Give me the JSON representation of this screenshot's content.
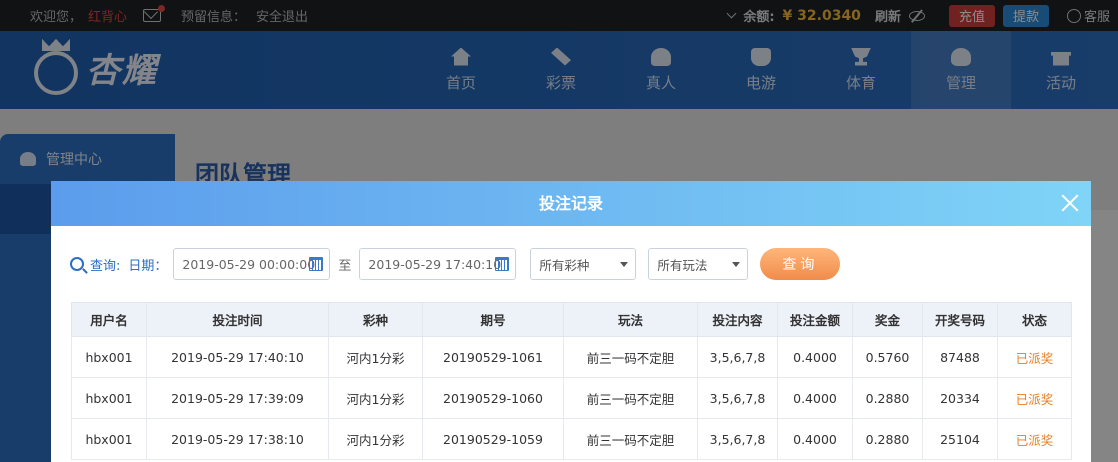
{
  "topbar": {
    "welcome": "欢迎您，",
    "username": "红背心",
    "alert_label": "预留信息：",
    "logout": "安全退出",
    "balance_label": "余额:",
    "balance_value": "¥ 32.0340",
    "refresh": "刷新",
    "recharge": "充值",
    "withdraw": "提款",
    "service": "客服"
  },
  "brand": {
    "logo_text": "杏耀"
  },
  "nav": [
    {
      "label": "首页",
      "icon": "home-icon"
    },
    {
      "label": "彩票",
      "icon": "ticket-icon"
    },
    {
      "label": "真人",
      "icon": "live-dealer-icon"
    },
    {
      "label": "电游",
      "icon": "slot-machine-icon"
    },
    {
      "label": "体育",
      "icon": "trophy-icon"
    },
    {
      "label": "管理",
      "icon": "users-icon"
    },
    {
      "label": "活动",
      "icon": "gift-icon"
    }
  ],
  "sidebar": {
    "header": "管理中心"
  },
  "content": {
    "title": "团队管理"
  },
  "modal": {
    "title": "投注记录",
    "filters": {
      "query_label": "查询:",
      "date_label": "日期：",
      "start_date": "2019-05-29 00:00:00",
      "to_label": "至",
      "end_date": "2019-05-29 17:40:10",
      "lottery_type": "所有彩种",
      "play_type": "所有玩法",
      "query_button": "查询"
    },
    "table": {
      "columns": [
        "用户名",
        "投注时间",
        "彩种",
        "期号",
        "玩法",
        "投注内容",
        "投注金额",
        "奖金",
        "开奖号码",
        "状态"
      ],
      "rows": [
        [
          "hbx001",
          "2019-05-29 17:40:10",
          "河内1分彩",
          "20190529-1061",
          "前三一码不定胆",
          "3,5,6,7,8",
          "0.4000",
          "0.5760",
          "87488",
          "已派奖"
        ],
        [
          "hbx001",
          "2019-05-29 17:39:09",
          "河内1分彩",
          "20190529-1060",
          "前三一码不定胆",
          "3,5,6,7,8",
          "0.4000",
          "0.2880",
          "20334",
          "已派奖"
        ],
        [
          "hbx001",
          "2019-05-29 17:38:10",
          "河内1分彩",
          "20190529-1059",
          "前三一码不定胆",
          "3,5,6,7,8",
          "0.4000",
          "0.2880",
          "25104",
          "已派奖"
        ]
      ]
    }
  }
}
